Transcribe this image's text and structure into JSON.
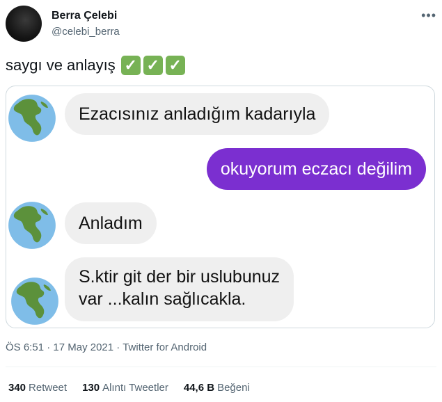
{
  "author": {
    "name": "Berra Çelebi",
    "handle": "@celebi_berra",
    "more_icon": "more-dots-icon"
  },
  "tweet": {
    "text": "saygı ve anlayış",
    "emoji": [
      "✓",
      "✓",
      "✓"
    ],
    "emoji_color": "#77b255"
  },
  "chat": {
    "sent_color": "#7b2fd0",
    "received_color": "#efefef",
    "avatar_icon": "earth-americas-icon",
    "messages": [
      {
        "side": "received",
        "text": "Ezacısınız anladığım kadarıyla"
      },
      {
        "side": "sent",
        "text": "okuyorum eczacı değilim"
      },
      {
        "side": "received",
        "text": "Anladım"
      },
      {
        "side": "received",
        "lines": [
          "S.ktir git der bir uslubunuz",
          "var ...kalın sağlıcakla."
        ]
      }
    ]
  },
  "meta": {
    "time": "ÖS 6:51",
    "date": "17 May 2021",
    "source": "Twitter for Android",
    "sep": "·"
  },
  "stats": {
    "retweets": {
      "count": "340",
      "label": "Retweet"
    },
    "quotes": {
      "count": "130",
      "label": "Alıntı Tweetler"
    },
    "likes": {
      "count": "44,6 B",
      "label": "Beğeni"
    }
  }
}
